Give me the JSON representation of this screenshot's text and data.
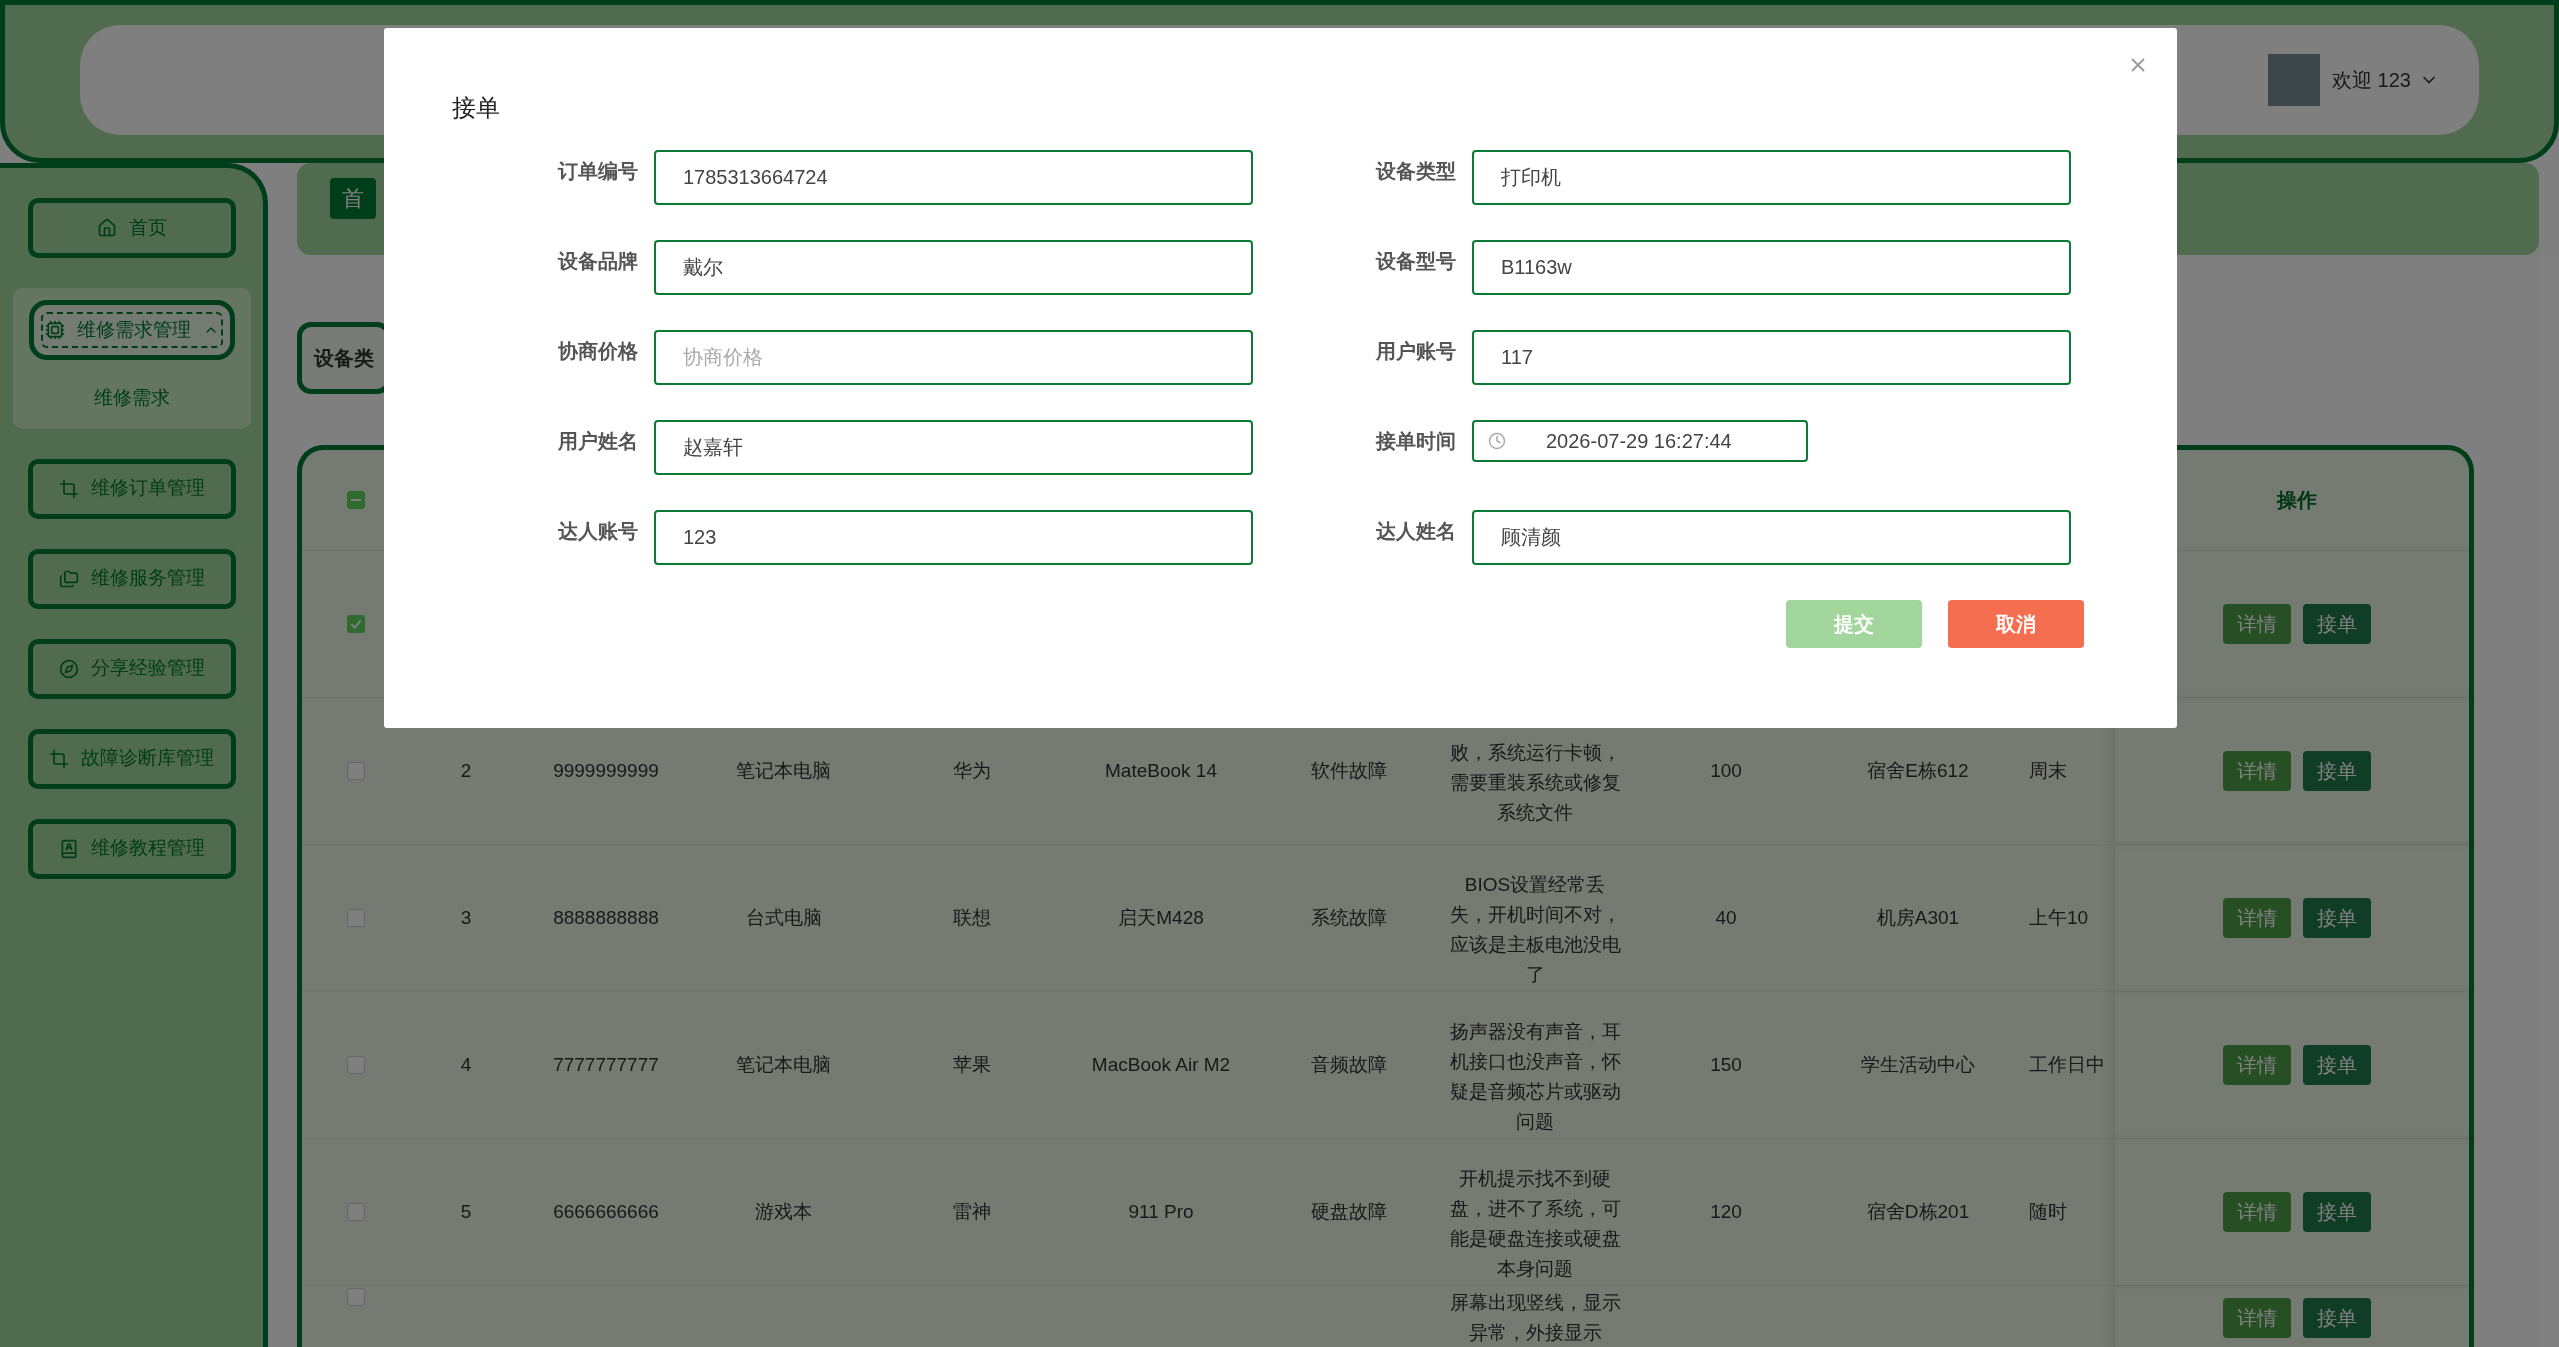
{
  "header": {
    "greeting": "欢迎 123"
  },
  "sidebar": {
    "items": [
      {
        "label": "首页"
      },
      {
        "label": "维修需求管理",
        "expanded": true,
        "children": [
          {
            "label": "维修需求"
          }
        ]
      },
      {
        "label": "维修订单管理"
      },
      {
        "label": "维修服务管理"
      },
      {
        "label": "分享经验管理"
      },
      {
        "label": "故障诊断库管理"
      },
      {
        "label": "维修教程管理"
      }
    ]
  },
  "breadcrumb": {
    "items": [
      "首"
    ]
  },
  "search": {
    "label": "设备类"
  },
  "table": {
    "select_all_indeterminate": true,
    "action_heading": "操作",
    "rows": [
      {
        "selected": true,
        "actions": [
          "详情",
          "接单"
        ]
      },
      {
        "selected": false,
        "index": "2",
        "order_no": "9999999999",
        "device_type": "笔记本电脑",
        "brand": "华为",
        "model": "MateBook 14",
        "fault": "软件故障",
        "description": "败，系统运行卡顿，需要重装系统或修复系统文件",
        "price": "100",
        "location": "宿舍E栋612",
        "time": "周末",
        "actions": [
          "详情",
          "接单"
        ]
      },
      {
        "selected": false,
        "index": "3",
        "order_no": "8888888888",
        "device_type": "台式电脑",
        "brand": "联想",
        "model": "启天M428",
        "fault": "系统故障",
        "description": "BIOS设置经常丢失，开机时间不对，应该是主板电池没电了",
        "price": "40",
        "location": "机房A301",
        "time": "上午10",
        "actions": [
          "详情",
          "接单"
        ]
      },
      {
        "selected": false,
        "index": "4",
        "order_no": "7777777777",
        "device_type": "笔记本电脑",
        "brand": "苹果",
        "model": "MacBook Air M2",
        "fault": "音频故障",
        "description": "扬声器没有声音，耳机接口也没声音，怀疑是音频芯片或驱动问题",
        "price": "150",
        "location": "学生活动中心",
        "time": "工作日中",
        "actions": [
          "详情",
          "接单"
        ]
      },
      {
        "selected": false,
        "index": "5",
        "order_no": "6666666666",
        "device_type": "游戏本",
        "brand": "雷神",
        "model": "911 Pro",
        "fault": "硬盘故障",
        "description": "开机提示找不到硬盘，进不了系统，可能是硬盘连接或硬盘本身问题",
        "price": "120",
        "location": "宿舍D栋201",
        "time": "随时",
        "actions": [
          "详情",
          "接单"
        ]
      },
      {
        "selected": false,
        "description": "屏幕出现竖线，显示异常，外接显示",
        "actions": [
          "详情",
          "接单"
        ]
      }
    ]
  },
  "modal": {
    "title": "接单",
    "fields": [
      {
        "kind": "text",
        "label": "订单编号",
        "value": "1785313664724"
      },
      {
        "kind": "text",
        "label": "设备类型",
        "value": "打印机"
      },
      {
        "kind": "text",
        "label": "设备品牌",
        "value": "戴尔"
      },
      {
        "kind": "text",
        "label": "设备型号",
        "value": "B1163w"
      },
      {
        "kind": "text",
        "label": "协商价格",
        "placeholder": "协商价格"
      },
      {
        "kind": "text",
        "label": "用户账号",
        "value": "117"
      },
      {
        "kind": "text",
        "label": "用户姓名",
        "value": "赵嘉轩"
      },
      {
        "kind": "datetime",
        "label": "接单时间",
        "value": "2026-07-29 16:27:44"
      },
      {
        "kind": "text",
        "label": "达人账号",
        "value": "123"
      },
      {
        "kind": "text",
        "label": "达人姓名",
        "value": "顾清颜"
      }
    ],
    "buttons": [
      {
        "kind": "primary",
        "label": "提交"
      },
      {
        "kind": "danger",
        "label": "取消"
      }
    ]
  }
}
